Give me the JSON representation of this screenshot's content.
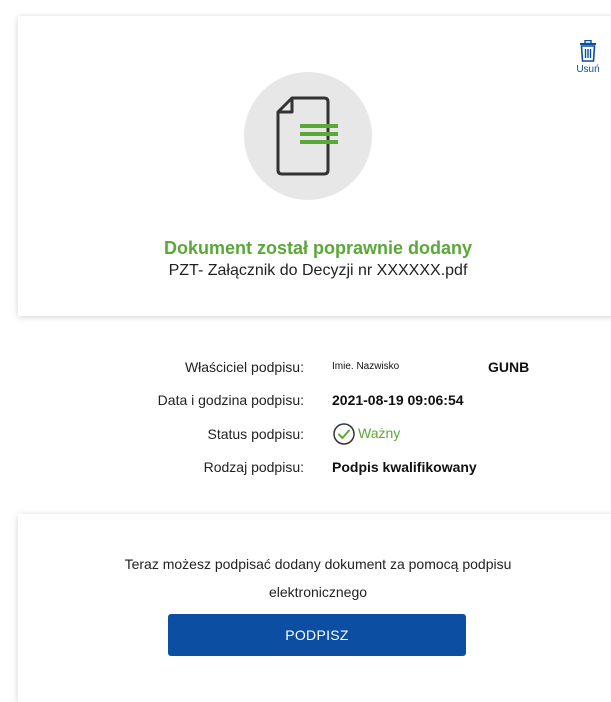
{
  "upload_card": {
    "delete_label": "Usuń",
    "success_message": "Dokument został poprawnie dodany",
    "file_name": "PZT- Załącznik do Decyzji nr XXXXXX.pdf"
  },
  "signature": {
    "owner_label": "Właściciel podpisu:",
    "owner_name": "Imie. Nazwisko",
    "owner_org": "GUNB",
    "date_label": "Data i godzina podpisu:",
    "date_value": "2021-08-19 09:06:54",
    "status_label": "Status podpisu:",
    "status_value": "Ważny",
    "type_label": "Rodzaj podpisu:",
    "type_value": "Podpis kwalifikowany"
  },
  "sign_card": {
    "message_line1": "Teraz możesz podpisać dodany dokument za pomocą podpisu",
    "message_line2": "elektronicznego",
    "button_label": "PODPISZ"
  },
  "colors": {
    "accent_blue": "#0b4ea2",
    "success_green": "#5aa838",
    "doc_circle_bg": "#e7e7e7"
  },
  "icons": {
    "delete": "trash-icon",
    "document": "document-icon",
    "status": "check-circle-icon"
  }
}
